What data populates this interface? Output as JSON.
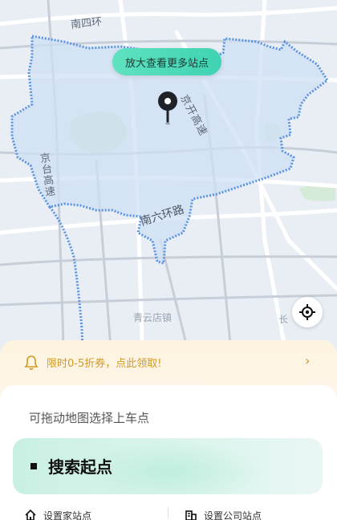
{
  "map": {
    "labels": {
      "nansihuan": "南四环",
      "jingkai_gaosu": "京开高速",
      "jingtai_gaosu": "京台高速",
      "nanliuhuan": "南六环路",
      "qingyundian": "青云店镇",
      "chang": "长"
    },
    "zoom_tip": "放大查看更多站点"
  },
  "promo": {
    "text": "限时0-5折券，点此领取!",
    "arrow": "›"
  },
  "sheet": {
    "hint": "可拖动地图选择上车点",
    "search_label": "搜索起点",
    "home_label": "设置家站点",
    "company_label": "设置公司站点"
  },
  "colors": {
    "accent": "#3fd3b3",
    "promo_text": "#d19a23",
    "region_border": "#5b93e0",
    "region_fill": "#cfe0f4"
  }
}
